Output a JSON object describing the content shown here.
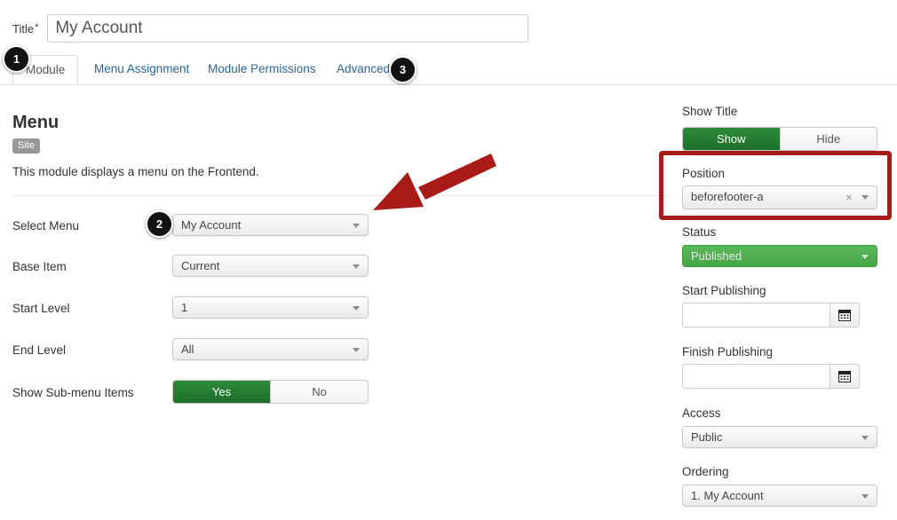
{
  "form": {
    "title_label": "Title",
    "title_required_mark": "*",
    "title_value": "My Account",
    "title_placeholder": ""
  },
  "tabs": [
    {
      "label": "Module",
      "active": true
    },
    {
      "label": "Menu Assignment",
      "active": false
    },
    {
      "label": "Module Permissions",
      "active": false
    },
    {
      "label": "Advanced",
      "active": false
    }
  ],
  "left_panel": {
    "heading": "Menu",
    "badge": "Site",
    "description": "This module displays a menu on the Frontend.",
    "fields": [
      {
        "label": "Select Menu",
        "value": "My Account",
        "type": "select"
      },
      {
        "label": "Base Item",
        "value": "Current",
        "type": "select"
      },
      {
        "label": "Start Level",
        "value": "1",
        "type": "select"
      },
      {
        "label": "End Level",
        "value": "All",
        "type": "select"
      }
    ],
    "submenu": {
      "label": "Show Sub-menu Items",
      "yes_label": "Yes",
      "no_label": "No",
      "selected": "Yes"
    }
  },
  "right_panel": {
    "show_title": {
      "label": "Show Title",
      "show_label": "Show",
      "hide_label": "Hide",
      "selected": "Show"
    },
    "position": {
      "label": "Position",
      "value": "beforefooter-a",
      "clear_glyph": "×"
    },
    "status": {
      "label": "Status",
      "value": "Published"
    },
    "start_publishing": {
      "label": "Start Publishing",
      "value": "",
      "placeholder": ""
    },
    "finish_publishing": {
      "label": "Finish Publishing",
      "value": "",
      "placeholder": ""
    },
    "access": {
      "label": "Access",
      "value": "Public"
    },
    "ordering": {
      "label": "Ordering",
      "value": "1. My Account"
    }
  },
  "annotations": {
    "badge1": "1",
    "badge2": "2",
    "badge3": "3",
    "highlight_color": "#a81b16",
    "arrow_color": "#a81b16"
  }
}
